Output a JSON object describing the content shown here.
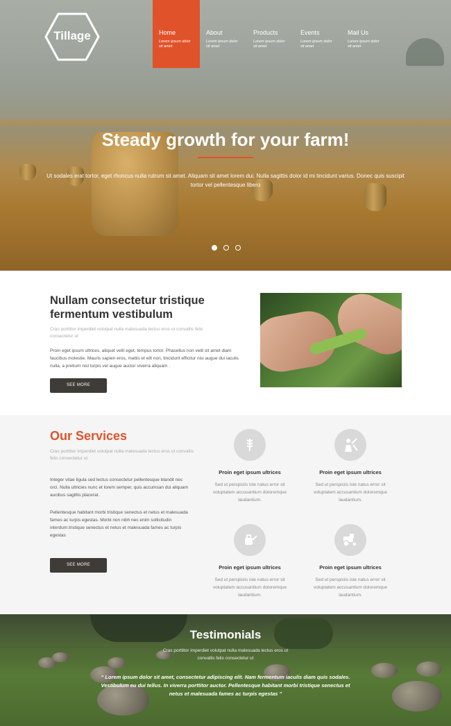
{
  "brand": {
    "logo_text": "Tillage",
    "accent": "#e0522a"
  },
  "nav": {
    "items": [
      {
        "label": "Home",
        "sub": "Lorem ipsum dolor sit amet"
      },
      {
        "label": "About",
        "sub": "Lorem ipsum dolor sit amet"
      },
      {
        "label": "Products",
        "sub": "Lorem ipsum dolor sit amet"
      },
      {
        "label": "Events",
        "sub": "Lorem ipsum dolor sit amet"
      },
      {
        "label": "Mail Us",
        "sub": "Lorem ipsum dolor sit amet"
      }
    ]
  },
  "hero": {
    "title_pre": "Steady ",
    "title_strong": "growth",
    "title_post": " for your farm!",
    "text": "Ut sodales erat tortor, eget rhoncus nulla rutrum sit amet. Aliquam sit amet lorem dui. Nulla sagittis dolor id mi tincidunt varius. Donec quis suscipit tortor vel pellentesque libero"
  },
  "about": {
    "title": "Nullam consectetur tristique fermentum vestibulum",
    "subtitle": "Cras porttitor imperdiet volutpat nulla malesuada lectus eros ut convallis felis consectetur ut",
    "body": "Proin eget ipsum ultrices, aliquet velit eget, tempus tortor. Phasellus non velit sit amet diam faucibus molestie. Mauris sapien eros, mattis et elit non, tincidunt efficitur nisi augue dui iaculis nulla, a pretium nisl turpis vel augue auctor viverra aliquam .",
    "button": "SEE MORE"
  },
  "services": {
    "title": "Our Services",
    "subtitle": "Cras porttitor imperdiet volutpat nulla malesuada lectus eros ut convallis felis consectetur ut",
    "para1": "Integer vitae ligula sed lectus consectetur pellentesque blandit nec orci. Nulla ultricies nunc et lorem semper, quis accumsan dui aliquam aucibus sagittis placerat.",
    "para2": "Pellentesque habitant morbi tristique senectus et netus et malesuada fames ac turpis egestas. Morbi non nibh nec enim sollicitudin interdum.tristique senectus et netus et malesuada fames ac turpis egestas",
    "button": "SEE MORE",
    "cards": [
      {
        "icon": "wheat-icon",
        "title": "Proin eget ipsum ultrices",
        "text": "Sed ut perspiciis iste natus error sit voluptatem accusantium doloremque laudantium."
      },
      {
        "icon": "farmer-icon",
        "title": "Proin eget ipsum ultrices",
        "text": "Sed ut perspiciis iste natus error sit voluptatem accusantium doloremque laudantium."
      },
      {
        "icon": "watering-can-icon",
        "title": "Proin eget ipsum ultrices",
        "text": "Sed ut perspiciis iste natus error sit voluptatem accusantium doloremque laudantium."
      },
      {
        "icon": "tractor-icon",
        "title": "Proin eget ipsum ultrices",
        "text": "Sed ut perspiciis iste natus error sit voluptatem accusantium doloremque laudantium."
      }
    ]
  },
  "testimonials": {
    "title": "Testimonials",
    "subtitle": "Cras porttitor imperdiet volutpat nulla malesuada lectus eros ut convallis felis consectetur ut",
    "quote": "“ Lorem ipsum dolor sit amet, consectetur adipiscing elit. Nam fermentum iaculis diam quis sodales. Vestibulum eu dui tellus. In viverra porttitor auctor. Pellentesque habitant morbi tristique senectus et netus et malesuada fames ac turpis egestas ”"
  }
}
